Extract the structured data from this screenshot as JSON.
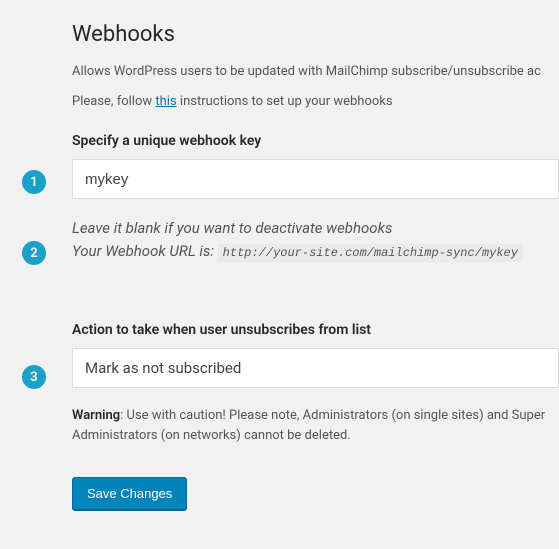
{
  "header": {
    "title": "Webhooks",
    "description": "Allows WordPress users to be updated with MailChimp subscribe/unsubscribe ac",
    "follow_pre": "Please, follow ",
    "follow_link": "this",
    "follow_post": " instructions to set up your webhooks"
  },
  "key_field": {
    "label": "Specify a unique webhook key",
    "value": "mykey"
  },
  "hint": {
    "line1": "Leave it blank if you want to deactivate webhooks",
    "line2_pre": "Your Webhook URL is: ",
    "url": "http://your-site.com/mailchimp-sync/mykey"
  },
  "action_field": {
    "label": "Action to take when user unsubscribes from list",
    "selected": "Mark as not subscribed"
  },
  "warning": {
    "bold": "Warning",
    "text": ": Use with caution! Please note, Administrators (on single sites) and Super Administrators (on networks) cannot be deleted."
  },
  "buttons": {
    "save": "Save Changes"
  },
  "badges": {
    "b1": "1",
    "b2": "2",
    "b3": "3"
  }
}
